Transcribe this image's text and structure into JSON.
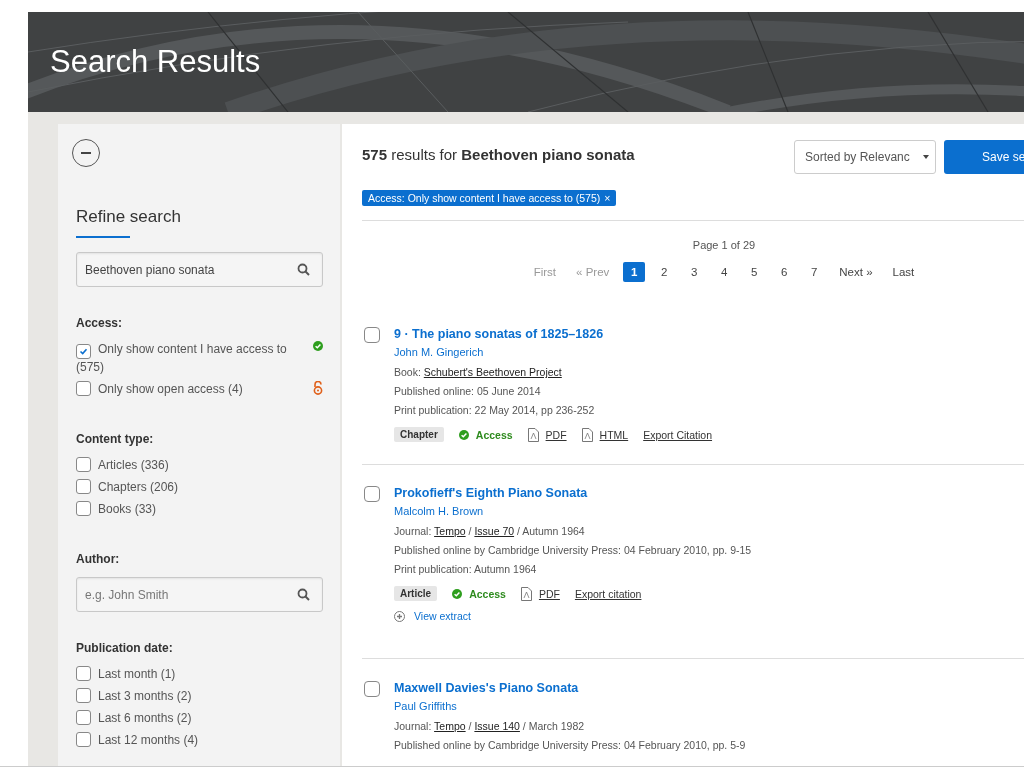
{
  "header": {
    "title": "Search Results"
  },
  "sidebar": {
    "refine_title": "Refine search",
    "search": {
      "value": "Beethoven piano sonata"
    },
    "sections": [
      {
        "kind": "checklist",
        "title": "Access:",
        "options": [
          {
            "label": "Only show content I have access to (575)",
            "checked": true,
            "kind": "access"
          },
          {
            "label": "Only show open access (4)",
            "checked": false,
            "kind": "open_access"
          }
        ]
      },
      {
        "kind": "checklist",
        "title": "Content type:",
        "options": [
          {
            "label": "Articles (336)",
            "checked": false,
            "kind": "plain"
          },
          {
            "label": "Chapters (206)",
            "checked": false,
            "kind": "plain"
          },
          {
            "label": "Books (33)",
            "checked": false,
            "kind": "plain"
          }
        ]
      },
      {
        "kind": "field",
        "title": "Author:",
        "placeholder": "e.g. John Smith"
      },
      {
        "kind": "checklist",
        "title": "Publication date:",
        "options": [
          {
            "label": "Last month (1)",
            "checked": false,
            "kind": "plain"
          },
          {
            "label": "Last 3 months (2)",
            "checked": false,
            "kind": "plain"
          },
          {
            "label": "Last 6 months (2)",
            "checked": false,
            "kind": "plain"
          },
          {
            "label": "Last 12 months (4)",
            "checked": false,
            "kind": "plain"
          }
        ]
      }
    ]
  },
  "main": {
    "summary": "**575** results for **Beethoven piano sonata**",
    "sort": {
      "value": "Sorted by Relevanc"
    },
    "save_button": "Save se",
    "filter_chip": {
      "label": "Access: Only show content I have access to (575)",
      "remove": "×"
    },
    "pagination": {
      "caption": "Page 1 of 29",
      "items": [
        {
          "label": "First",
          "kind": "nav",
          "disabled": true,
          "selected": false
        },
        {
          "label": "« Prev",
          "kind": "nav",
          "disabled": true,
          "selected": false
        },
        {
          "label": "1",
          "kind": "page",
          "disabled": false,
          "selected": true
        },
        {
          "label": "2",
          "kind": "page",
          "disabled": false,
          "selected": false
        },
        {
          "label": "3",
          "kind": "page",
          "disabled": false,
          "selected": false
        },
        {
          "label": "4",
          "kind": "page",
          "disabled": false,
          "selected": false
        },
        {
          "label": "5",
          "kind": "page",
          "disabled": false,
          "selected": false
        },
        {
          "label": "6",
          "kind": "page",
          "disabled": false,
          "selected": false
        },
        {
          "label": "7",
          "kind": "page",
          "disabled": false,
          "selected": false
        },
        {
          "label": "Next »",
          "kind": "nav",
          "disabled": false,
          "selected": false
        },
        {
          "label": "Last",
          "kind": "nav",
          "disabled": false,
          "selected": false
        }
      ]
    },
    "results": [
      {
        "checked": false,
        "title": "9 · The piano sonatas of 1825–1826",
        "author": "John M. Gingerich",
        "meta": [
          [
            {
              "text": "Book: ",
              "link": false
            },
            {
              "text": "Schubert's Beethoven Project",
              "link": true
            }
          ],
          [
            {
              "text": "Published online: 05 June 2014",
              "link": false
            }
          ],
          [
            {
              "text": "Print publication: 22 May 2014, pp 236-252",
              "link": false
            }
          ]
        ],
        "actions": [
          {
            "kind": "tag",
            "label": "Chapter"
          },
          {
            "kind": "access",
            "label": "Access"
          },
          {
            "kind": "pdf",
            "label": "PDF"
          },
          {
            "kind": "html",
            "label": "HTML"
          },
          {
            "kind": "citation",
            "label": "Export Citation"
          }
        ]
      },
      {
        "checked": false,
        "title": "Prokofieff's Eighth Piano Sonata",
        "author": "Malcolm H. Brown",
        "meta": [
          [
            {
              "text": "Journal: ",
              "link": false
            },
            {
              "text": "Tempo",
              "link": true
            },
            {
              "text": " / ",
              "link": false
            },
            {
              "text": "Issue 70",
              "link": true
            },
            {
              "text": " / Autumn 1964",
              "link": false
            }
          ],
          [
            {
              "text": "Published online by Cambridge University Press: 04 February 2010, pp. 9-15",
              "link": false
            }
          ],
          [
            {
              "text": "Print publication: Autumn 1964",
              "link": false
            }
          ]
        ],
        "actions": [
          {
            "kind": "tag",
            "label": "Article"
          },
          {
            "kind": "access",
            "label": "Access"
          },
          {
            "kind": "pdf",
            "label": "PDF"
          },
          {
            "kind": "citation",
            "label": "Export citation"
          }
        ],
        "extract": "View extract"
      },
      {
        "checked": false,
        "title": "Maxwell Davies's Piano Sonata",
        "author": "Paul Griffiths",
        "meta": [
          [
            {
              "text": "Journal: ",
              "link": false
            },
            {
              "text": "Tempo",
              "link": true
            },
            {
              "text": " / ",
              "link": false
            },
            {
              "text": "Issue 140",
              "link": true
            },
            {
              "text": " / March 1982",
              "link": false
            }
          ],
          [
            {
              "text": "Published online by Cambridge University Press: 04 February 2010, pp. 5-9",
              "link": false
            }
          ]
        ]
      }
    ]
  }
}
